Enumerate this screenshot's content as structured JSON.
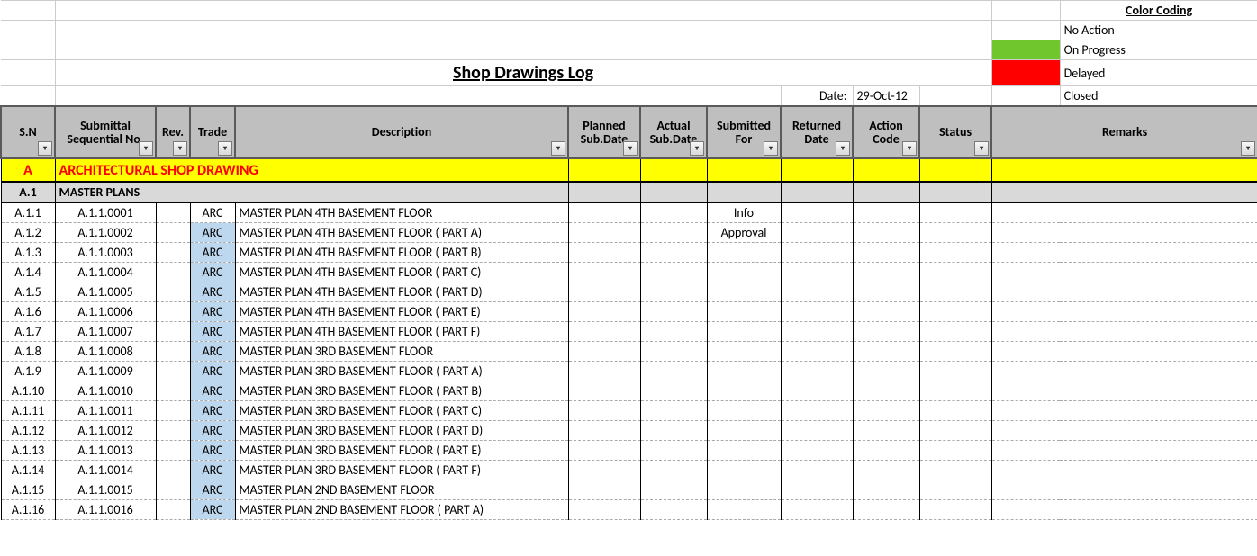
{
  "title": "Shop Drawings Log",
  "date_label": "Date:",
  "date_value": "29-Oct-12",
  "legend": {
    "title": "Color Coding",
    "items": [
      {
        "label": "No Action",
        "color": ""
      },
      {
        "label": "On Progress",
        "color": "#70C72D"
      },
      {
        "label": "Delayed",
        "color": "#FF0000"
      },
      {
        "label": "Closed",
        "color": ""
      }
    ]
  },
  "headers": {
    "sn": "S.N",
    "sub": "Submittal Sequential No.",
    "rev": "Rev.",
    "trade": "Trade",
    "desc": "Description",
    "plan": "Planned Sub.Date",
    "act": "Actual Sub.Date",
    "for": "Submitted For",
    "ret": "Returned Date",
    "code": "Action Code",
    "stat": "Status",
    "rem": "Remarks"
  },
  "section_a": {
    "sn": "A",
    "title": "ARCHITECTURAL SHOP DRAWING"
  },
  "section_a1": {
    "sn": "A.1",
    "title": "MASTER PLANS"
  },
  "rows": [
    {
      "sn": "A.1.1",
      "sub": "A.1.1.0001",
      "rev": "",
      "trade": "ARC",
      "trade_hi": false,
      "desc": "MASTER PLAN  4TH BASEMENT FLOOR",
      "for": "Info"
    },
    {
      "sn": "A.1.2",
      "sub": "A.1.1.0002",
      "rev": "",
      "trade": "ARC",
      "trade_hi": true,
      "desc": "MASTER PLAN  4TH BASEMENT FLOOR ( PART A)",
      "for": "Approval"
    },
    {
      "sn": "A.1.3",
      "sub": "A.1.1.0003",
      "rev": "",
      "trade": "ARC",
      "trade_hi": true,
      "desc": "MASTER PLAN  4TH BASEMENT FLOOR ( PART B)",
      "for": ""
    },
    {
      "sn": "A.1.4",
      "sub": "A.1.1.0004",
      "rev": "",
      "trade": "ARC",
      "trade_hi": true,
      "desc": "MASTER PLAN  4TH BASEMENT FLOOR ( PART C)",
      "for": ""
    },
    {
      "sn": "A.1.5",
      "sub": "A.1.1.0005",
      "rev": "",
      "trade": "ARC",
      "trade_hi": true,
      "desc": "MASTER PLAN  4TH BASEMENT FLOOR ( PART D)",
      "for": ""
    },
    {
      "sn": "A.1.6",
      "sub": "A.1.1.0006",
      "rev": "",
      "trade": "ARC",
      "trade_hi": true,
      "desc": "MASTER PLAN  4TH BASEMENT FLOOR ( PART E)",
      "for": ""
    },
    {
      "sn": "A.1.7",
      "sub": "A.1.1.0007",
      "rev": "",
      "trade": "ARC",
      "trade_hi": true,
      "desc": "MASTER PLAN  4TH BASEMENT FLOOR ( PART F)",
      "for": ""
    },
    {
      "sn": "A.1.8",
      "sub": "A.1.1.0008",
      "rev": "",
      "trade": "ARC",
      "trade_hi": true,
      "desc": "MASTER PLAN  3RD BASEMENT FLOOR",
      "for": ""
    },
    {
      "sn": "A.1.9",
      "sub": "A.1.1.0009",
      "rev": "",
      "trade": "ARC",
      "trade_hi": true,
      "desc": "MASTER PLAN  3RD BASEMENT FLOOR ( PART A)",
      "for": ""
    },
    {
      "sn": "A.1.10",
      "sub": "A.1.1.0010",
      "rev": "",
      "trade": "ARC",
      "trade_hi": true,
      "desc": "MASTER PLAN  3RD BASEMENT FLOOR ( PART B)",
      "for": ""
    },
    {
      "sn": "A.1.11",
      "sub": "A.1.1.0011",
      "rev": "",
      "trade": "ARC",
      "trade_hi": true,
      "desc": "MASTER PLAN  3RD BASEMENT FLOOR ( PART C)",
      "for": ""
    },
    {
      "sn": "A.1.12",
      "sub": "A.1.1.0012",
      "rev": "",
      "trade": "ARC",
      "trade_hi": true,
      "desc": "MASTER PLAN  3RD BASEMENT FLOOR ( PART D)",
      "for": ""
    },
    {
      "sn": "A.1.13",
      "sub": "A.1.1.0013",
      "rev": "",
      "trade": "ARC",
      "trade_hi": true,
      "desc": "MASTER PLAN  3RD BASEMENT FLOOR ( PART E)",
      "for": ""
    },
    {
      "sn": "A.1.14",
      "sub": "A.1.1.0014",
      "rev": "",
      "trade": "ARC",
      "trade_hi": true,
      "desc": "MASTER PLAN  3RD BASEMENT FLOOR ( PART F)",
      "for": ""
    },
    {
      "sn": "A.1.15",
      "sub": "A.1.1.0015",
      "rev": "",
      "trade": "ARC",
      "trade_hi": true,
      "desc": "MASTER PLAN  2ND BASEMENT FLOOR",
      "for": ""
    },
    {
      "sn": "A.1.16",
      "sub": "A.1.1.0016",
      "rev": "",
      "trade": "ARC",
      "trade_hi": true,
      "desc": "MASTER PLAN  2ND BASEMENT FLOOR ( PART A)",
      "for": ""
    }
  ]
}
